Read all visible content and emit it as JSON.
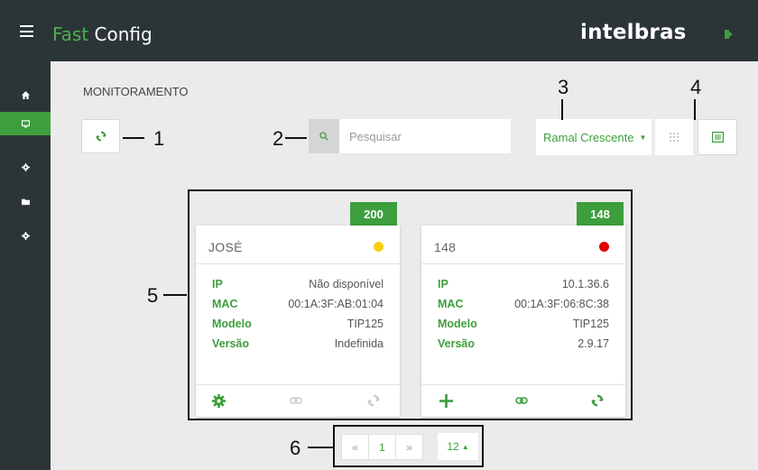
{
  "header": {
    "app_name_fast": "Fast",
    "app_name_config": " Config",
    "logo_text": "intelbras"
  },
  "sidebar": {
    "items": [
      {
        "icon": "home-icon",
        "active": false
      },
      {
        "icon": "monitor-icon",
        "active": true
      },
      {
        "icon": "gear-icon",
        "active": false
      },
      {
        "icon": "folder-icon",
        "active": false
      },
      {
        "icon": "gear-icon",
        "active": false
      }
    ]
  },
  "main": {
    "title": "MONITORAMENTO",
    "search_placeholder": "Pesquisar",
    "sort_label": "Ramal Crescente"
  },
  "annotations": [
    "1",
    "2",
    "3",
    "4",
    "5",
    "6"
  ],
  "cards": [
    {
      "extension": "200",
      "name": "JOSÉ",
      "status_color": "#f7cf0f",
      "labels": {
        "ip": "IP",
        "mac": "MAC",
        "model": "Modelo",
        "version": "Versão"
      },
      "ip": "Não disponível",
      "mac": "00:1A:3F:AB:01:04",
      "model": "TIP125",
      "version": "Indefinida"
    },
    {
      "extension": "148",
      "name": "148",
      "status_color": "#e00000",
      "labels": {
        "ip": "IP",
        "mac": "MAC",
        "model": "Modelo",
        "version": "Versão"
      },
      "ip": "10.1.36.6",
      "mac": "00:1A:3F:06:8C:38",
      "model": "TIP125",
      "version": "2.9.17"
    }
  ],
  "pagination": {
    "prev": "«",
    "current": "1",
    "next": "»",
    "page_size": "12"
  },
  "colors": {
    "accent": "#3d9e3d",
    "dark": "#2b3537"
  }
}
